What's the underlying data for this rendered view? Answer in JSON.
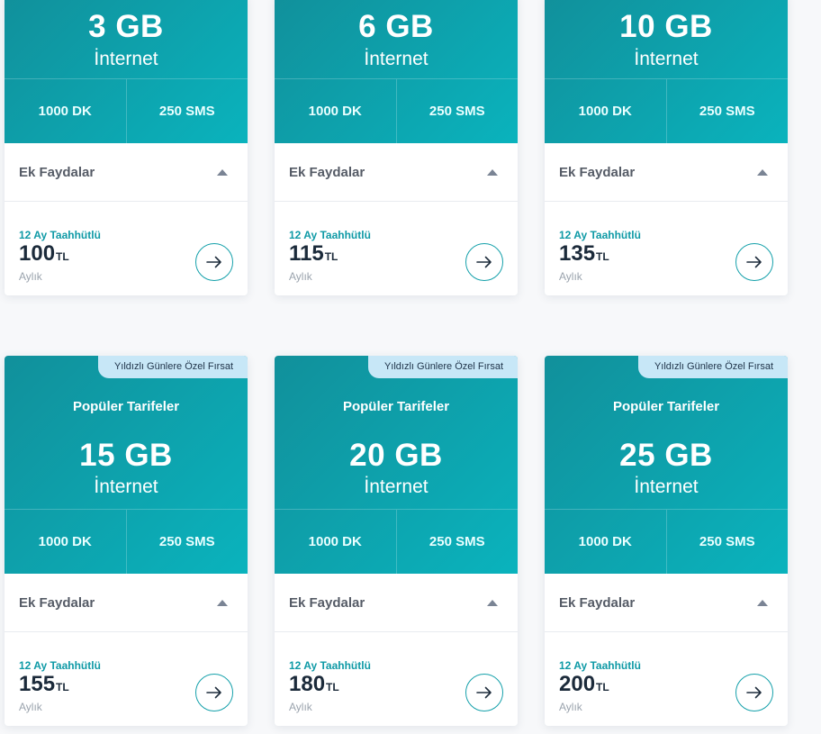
{
  "common": {
    "internet_label": "İnternet",
    "extras_label": "Ek Faydalar",
    "commitment": "12 Ay Taahhütlü",
    "monthly": "Aylık",
    "currency": "TL",
    "popular_label": "Popüler Tarifeler",
    "badge": "Yıldızlı Günlere Özel Fırsat"
  },
  "plans": [
    {
      "data": "3 GB",
      "minutes": "1000 DK",
      "sms": "250 SMS",
      "price": "100"
    },
    {
      "data": "6 GB",
      "minutes": "1000 DK",
      "sms": "250 SMS",
      "price": "115"
    },
    {
      "data": "10 GB",
      "minutes": "1000 DK",
      "sms": "250 SMS",
      "price": "135"
    },
    {
      "data": "15 GB",
      "minutes": "1000 DK",
      "sms": "250 SMS",
      "price": "155"
    },
    {
      "data": "20 GB",
      "minutes": "1000 DK",
      "sms": "250 SMS",
      "price": "180"
    },
    {
      "data": "25 GB",
      "minutes": "1000 DK",
      "sms": "250 SMS",
      "price": "200"
    }
  ],
  "colors": {
    "accent": "#0ab3bd",
    "accent_dark": "#11909b",
    "badge_bg": "#c7e7f7"
  }
}
